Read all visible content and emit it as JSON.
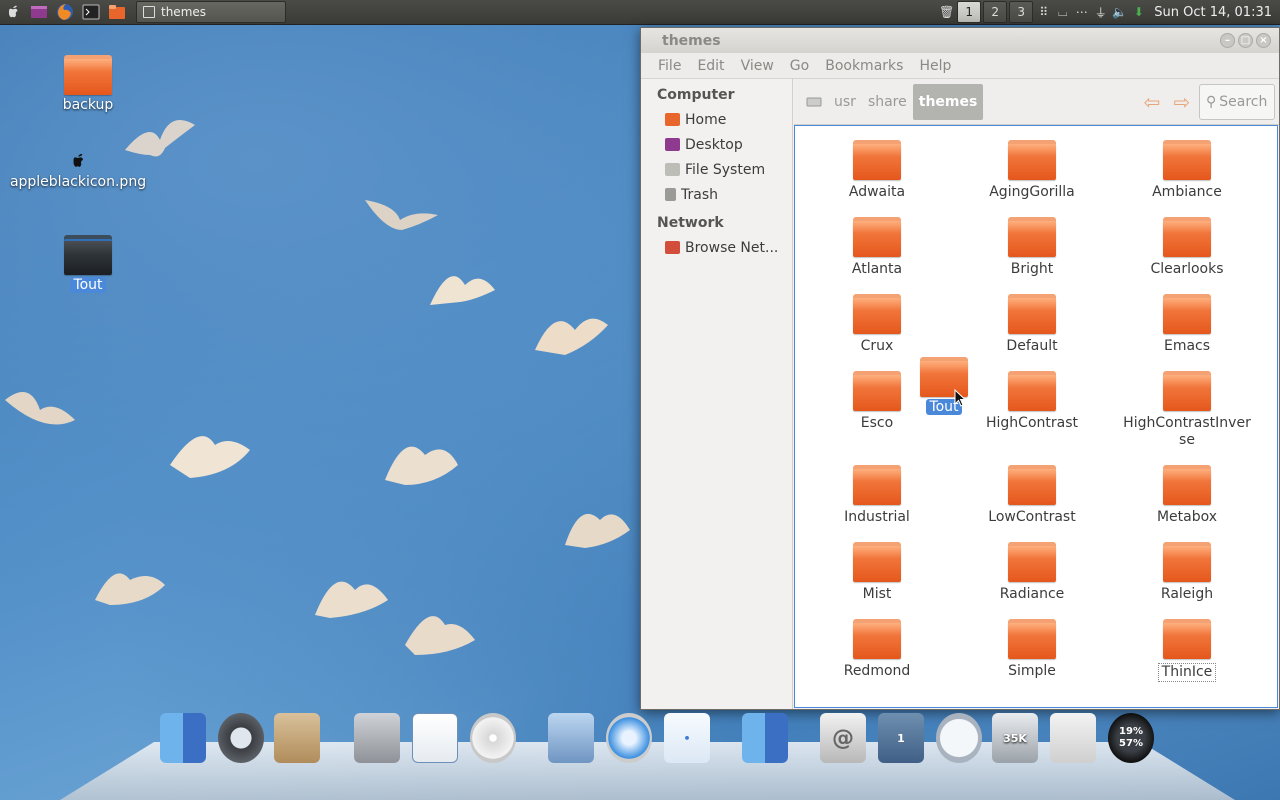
{
  "top_panel": {
    "launchers": [
      "apple-menu-icon",
      "app-launcher-icon",
      "firefox-icon",
      "terminal-icon",
      "file-manager-icon"
    ],
    "taskbar_window_title": "themes",
    "workspaces": [
      "1",
      "2",
      "3"
    ],
    "active_workspace": "1",
    "clock": "Sun Oct 14, 01:31"
  },
  "desktop": {
    "icons": [
      {
        "label": "backup"
      },
      {
        "label": "appleblackicon.png"
      },
      {
        "label": "Tout"
      }
    ]
  },
  "file_manager": {
    "title": "themes",
    "menu": [
      "File",
      "Edit",
      "View",
      "Go",
      "Bookmarks",
      "Help"
    ],
    "sidebar": {
      "computer_heading": "Computer",
      "computer_items": [
        "Home",
        "Desktop",
        "File System",
        "Trash"
      ],
      "network_heading": "Network",
      "network_items": [
        "Browse Net..."
      ]
    },
    "breadcrumbs": [
      "usr",
      "share",
      "themes"
    ],
    "search_placeholder": "Search",
    "folders": [
      "Adwaita",
      "AgingGorilla",
      "Ambiance",
      "Atlanta",
      "Bright",
      "Clearlooks",
      "Crux",
      "Default",
      "Emacs",
      "Esco",
      "HighContrast",
      "HighContrastInverse",
      "Industrial",
      "LowContrast",
      "Metabox",
      "Mist",
      "Radiance",
      "Raleigh",
      "Redmond",
      "Simple",
      "ThinIce"
    ],
    "dragging_item_label": "Tout"
  },
  "dock": {
    "items": [
      {
        "name": "finder-icon"
      },
      {
        "name": "time-machine-icon"
      },
      {
        "name": "package-box-icon"
      },
      {
        "name": "calculator-icon"
      },
      {
        "name": "text-editor-icon"
      },
      {
        "name": "cd-drive-icon"
      },
      {
        "name": "mail-eagle-icon"
      },
      {
        "name": "safari-icon"
      },
      {
        "name": "chat-icon"
      },
      {
        "name": "finder-icon-2"
      },
      {
        "name": "at-mail-icon"
      },
      {
        "name": "workspace-switcher-icon",
        "text": "1"
      },
      {
        "name": "clock-icon"
      },
      {
        "name": "trash-icon",
        "text": "35K"
      },
      {
        "name": "switch-icon"
      },
      {
        "name": "cpu-monitor-icon",
        "text": "19%",
        "text2": "57%"
      }
    ]
  }
}
